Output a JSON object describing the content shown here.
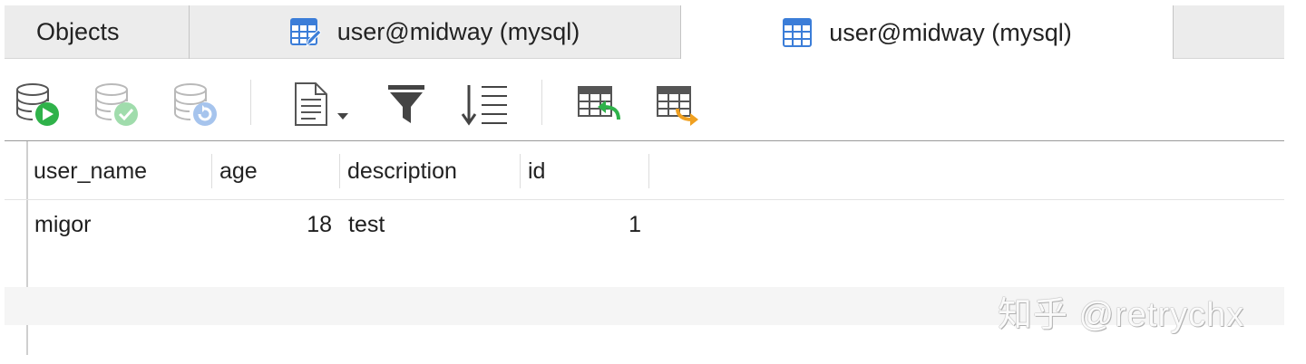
{
  "tabs": [
    {
      "label": "Objects",
      "icon": null,
      "active": false
    },
    {
      "label": "user@midway (mysql)",
      "icon": "table-edit-icon",
      "active": false
    },
    {
      "label": "user@midway (mysql)",
      "icon": "table-icon",
      "active": true
    }
  ],
  "toolbar": {
    "buttons": [
      {
        "icon": "database-run-icon",
        "enabled": true
      },
      {
        "icon": "database-commit-icon",
        "enabled": false
      },
      {
        "icon": "database-rollback-icon",
        "enabled": false
      },
      {
        "icon": "document-menu-icon",
        "enabled": true
      },
      {
        "icon": "filter-icon",
        "enabled": true
      },
      {
        "icon": "sort-icon",
        "enabled": true
      },
      {
        "icon": "table-import-icon",
        "enabled": true
      },
      {
        "icon": "table-export-icon",
        "enabled": true
      }
    ]
  },
  "grid": {
    "columns": [
      "user_name",
      "age",
      "description",
      "id"
    ],
    "rows": [
      {
        "user_name": "migor",
        "age": "18",
        "description": "test",
        "id": "1"
      }
    ]
  },
  "watermark": "知乎 @retrychx",
  "colors": {
    "accent_blue": "#3b7dd8",
    "run_green": "#2fb24a",
    "tab_bar_bg": "#ececec",
    "stripe": "#f5f5f5"
  }
}
